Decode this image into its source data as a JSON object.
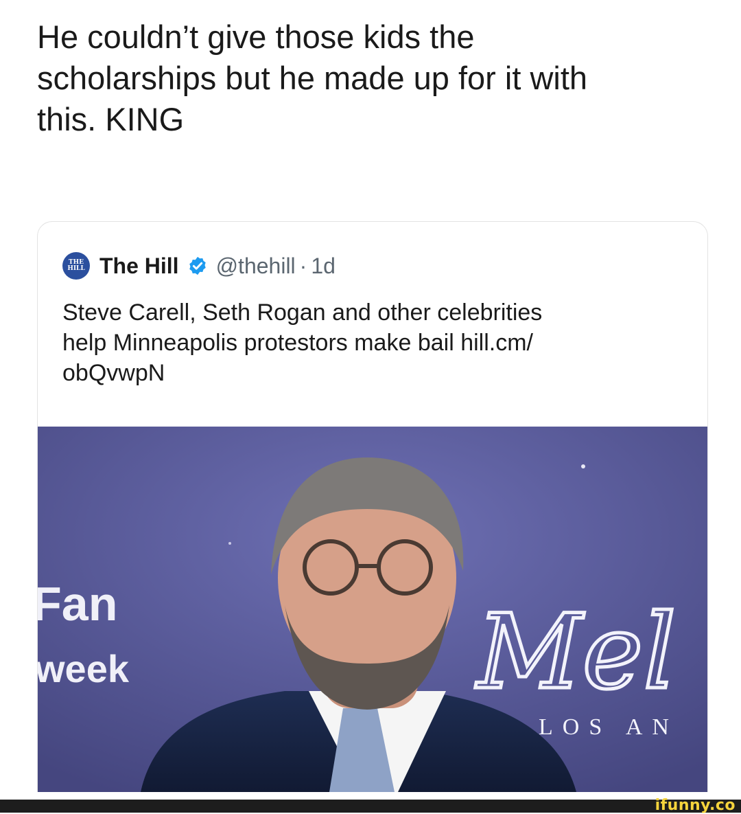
{
  "caption": {
    "line1": "He couldn’t give those kids the",
    "line2": "scholarships but he made up for it with",
    "line3": "this. KING"
  },
  "tweet": {
    "avatar_text_top": "THE",
    "avatar_text_bottom": "HILL",
    "account_name": "The Hill",
    "handle": "@thehill",
    "separator": "·",
    "time": "1d",
    "text_line1": "Steve Carell, Seth Rogan and other celebrities",
    "text_line2": "help Minneapolis protestors make bail hill.cm/",
    "text_line3": "obQvwpN",
    "verified_icon": "verified-badge-icon",
    "verified_color": "#1d9bf0"
  },
  "photo": {
    "backdrop_left_line1": "Fan",
    "backdrop_left_line2": "week",
    "backdrop_script": "Mel",
    "backdrop_right": "LOS AN",
    "backdrop_color": "#5b5c9e"
  },
  "watermark": "ifunny.co"
}
